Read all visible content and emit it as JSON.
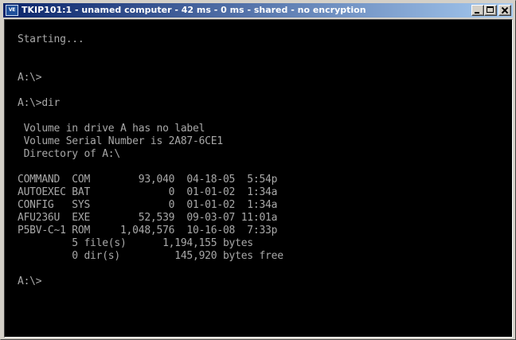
{
  "window": {
    "title": "TKIP101:1 - unamed computer - 42 ms - 0 ms - shared - no encryption",
    "app_icon_text": "VE",
    "colors": {
      "titlebar_start": "#0a246a",
      "titlebar_end": "#a6caf0",
      "console_bg": "#000000",
      "console_text": "#a8a8a8"
    },
    "icons": {
      "app": "remote-console-icon",
      "minimize": "minimize-icon",
      "maximize": "maximize-icon",
      "close": "close-icon"
    }
  },
  "console": {
    "lines": [
      "Starting...",
      "",
      "",
      "A:\\>",
      "",
      "A:\\>dir",
      "",
      " Volume in drive A has no label",
      " Volume Serial Number is 2A87-6CE1",
      " Directory of A:\\",
      "",
      "COMMAND  COM        93,040  04-18-05  5:54p",
      "AUTOEXEC BAT             0  01-01-02  1:34a",
      "CONFIG   SYS             0  01-01-02  1:34a",
      "AFU236U  EXE        52,539  09-03-07 11:01a",
      "P5BV-C~1 ROM     1,048,576  10-16-08  7:33p",
      "         5 file(s)      1,194,155 bytes",
      "         0 dir(s)         145,920 bytes free",
      "",
      "A:\\>"
    ]
  }
}
